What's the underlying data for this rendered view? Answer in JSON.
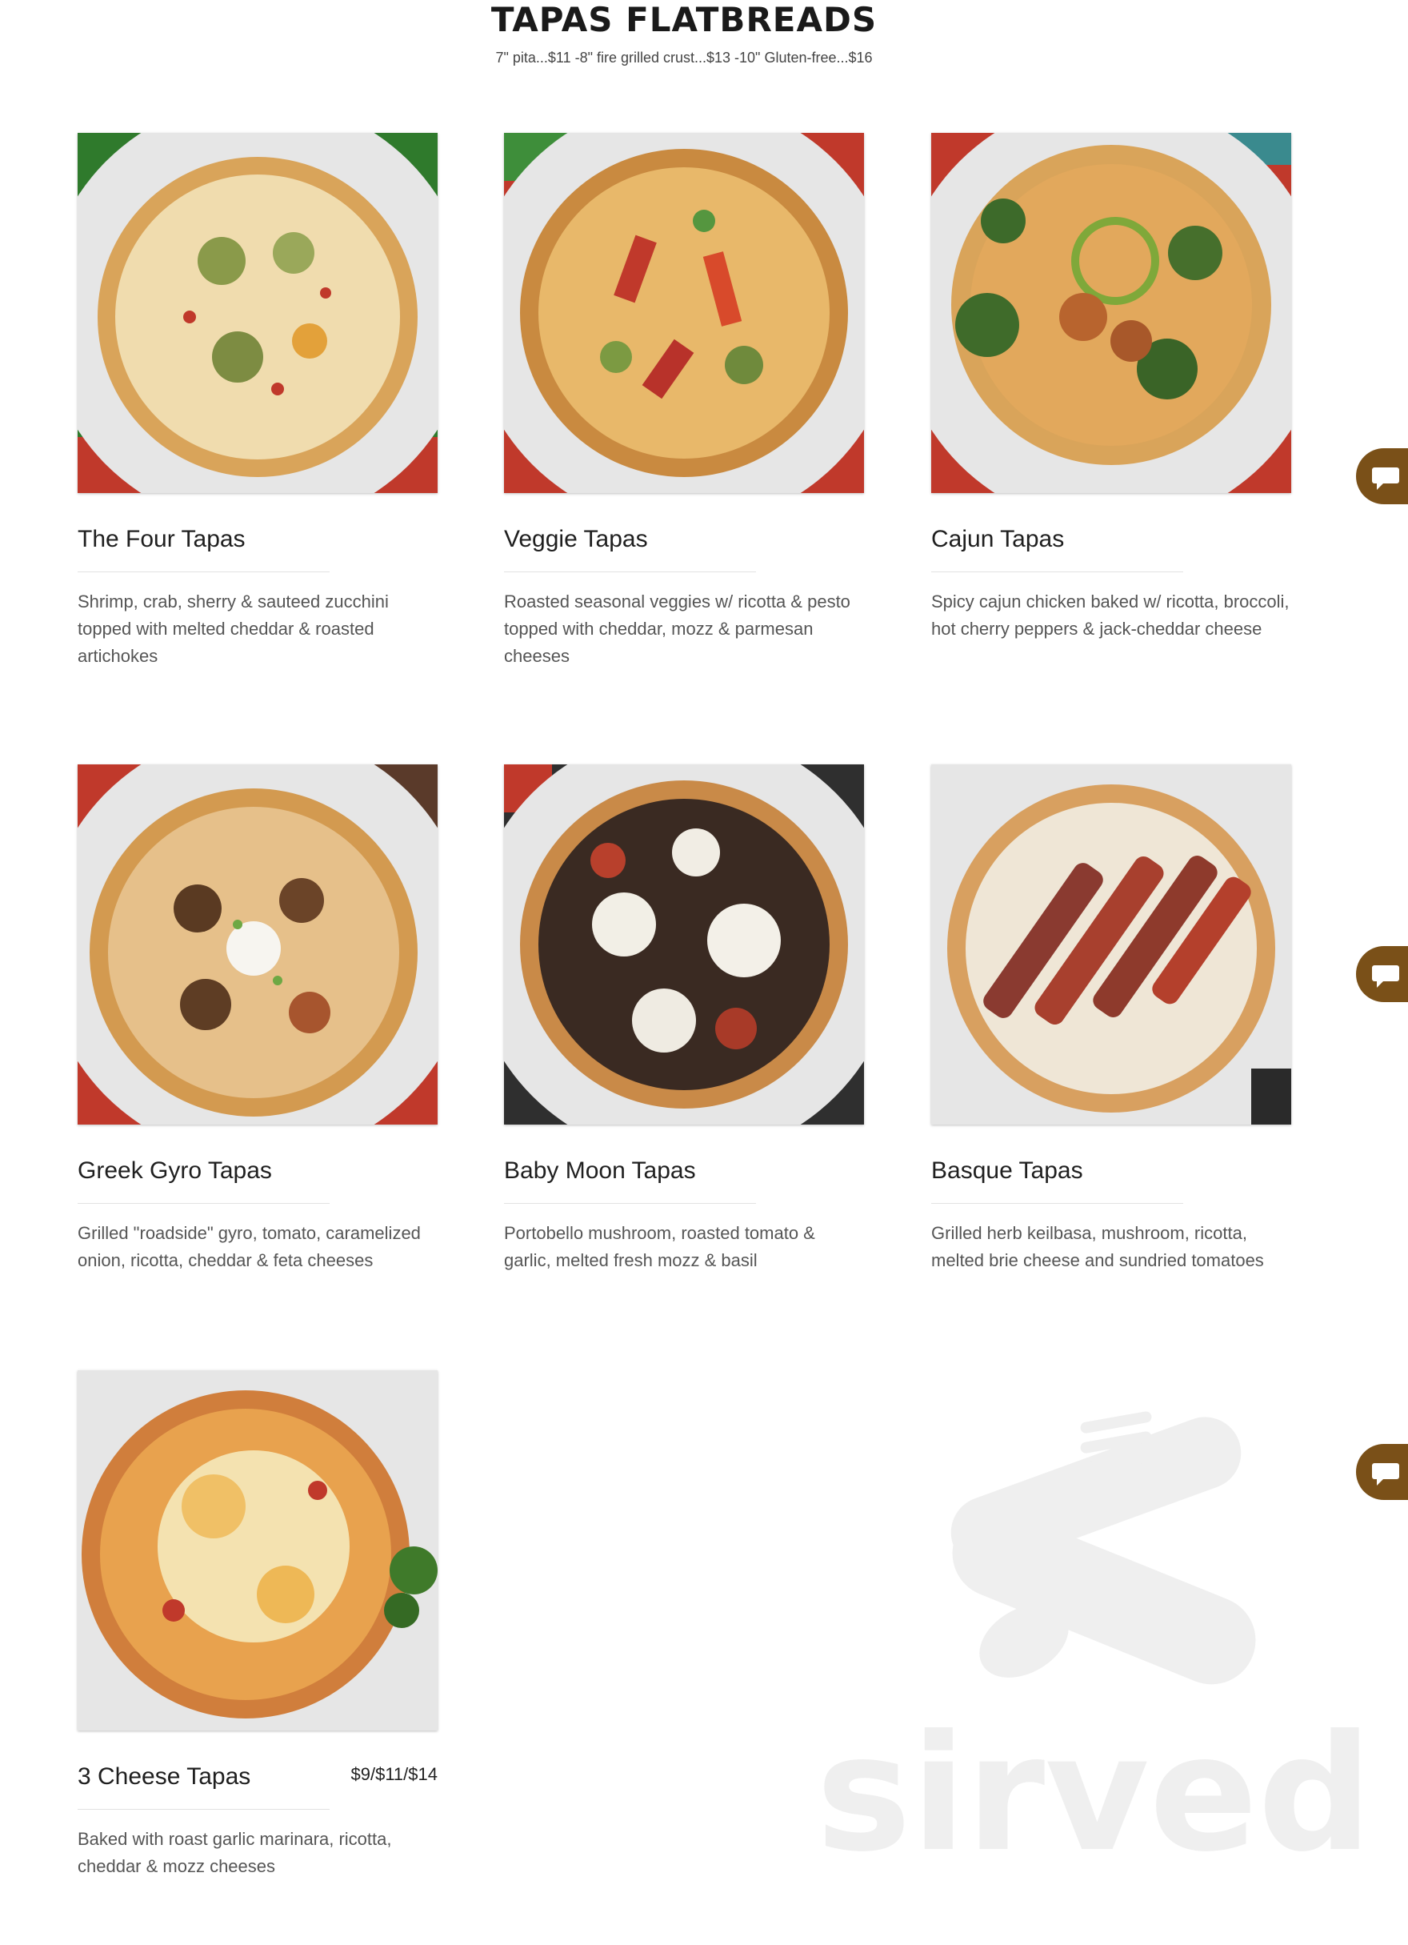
{
  "header": {
    "title": "TAPAS FLATBREADS",
    "subtitle": "7\" pita...$11 -8\" fire grilled crust...$13 -10\" Gluten-free...$16"
  },
  "items": [
    {
      "name": "The Four Tapas",
      "price": "",
      "description": "Shrimp, crab, sherry & sauteed zucchini topped with melted cheddar & roasted artichokes"
    },
    {
      "name": "Veggie Tapas",
      "price": "",
      "description": "Roasted seasonal veggies w/ ricotta & pesto topped with cheddar, mozz & parmesan cheeses"
    },
    {
      "name": "Cajun Tapas",
      "price": "",
      "description": "Spicy cajun chicken baked w/ ricotta, broccoli, hot cherry peppers & jack-cheddar cheese"
    },
    {
      "name": "Greek Gyro Tapas",
      "price": "",
      "description": "Grilled \"roadside\" gyro, tomato, caramelized onion, ricotta, cheddar & feta cheeses"
    },
    {
      "name": "Baby Moon Tapas",
      "price": "",
      "description": "Portobello mushroom, roasted tomato & garlic, melted fresh mozz & basil"
    },
    {
      "name": "Basque Tapas",
      "price": "",
      "description": "Grilled herb keilbasa, mushroom, ricotta, melted brie cheese and sundried tomatoes"
    },
    {
      "name": "3 Cheese Tapas",
      "price": "$9/$11/$14",
      "description": "Baked with roast garlic marinara, ricotta, cheddar & mozz cheeses"
    }
  ],
  "watermark": {
    "text": "sirved"
  },
  "colors": {
    "chat_button": "#7a5018",
    "watermark": "#efefef"
  },
  "icons": {
    "chat": "chat-bubble-icon",
    "watermark": "fork-knife-spoon-icon"
  }
}
